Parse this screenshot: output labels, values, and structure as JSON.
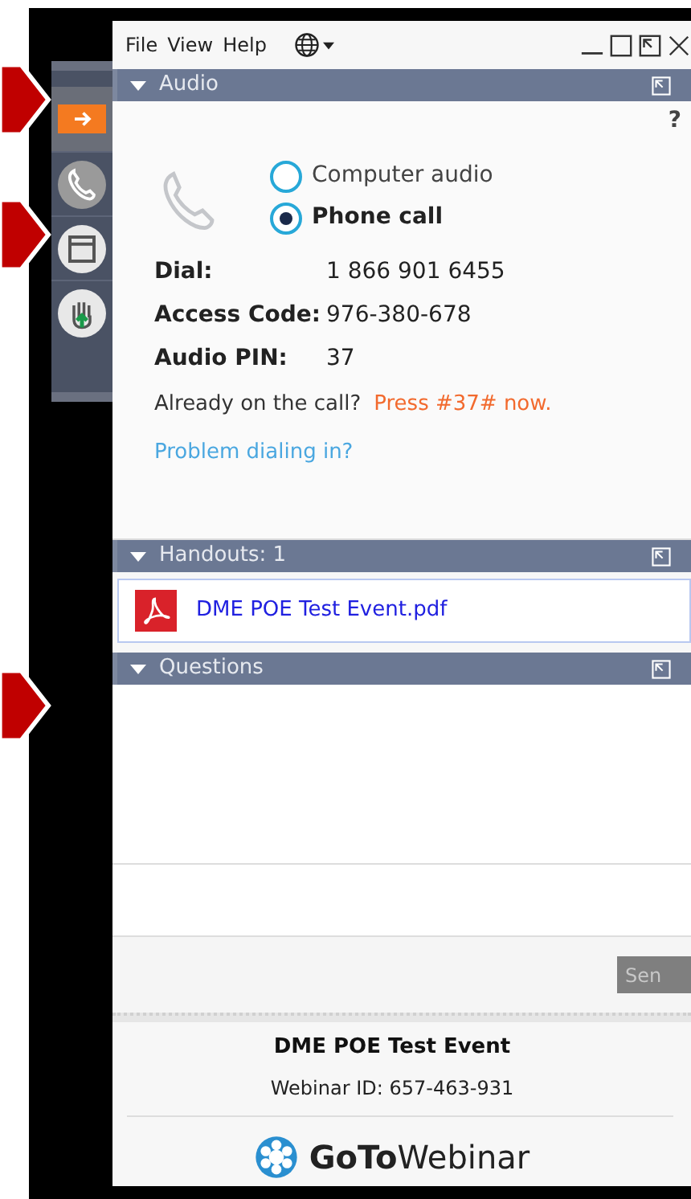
{
  "menu": [
    {
      "label": "File"
    },
    {
      "label": "View"
    },
    {
      "label": "Help"
    }
  ],
  "sidebar": {
    "items": [
      {
        "kind": "arrow",
        "selected": true
      },
      {
        "kind": "phone",
        "selected": false
      },
      {
        "kind": "window",
        "selected": false
      },
      {
        "kind": "hand",
        "selected": false
      }
    ]
  },
  "audio": {
    "title": "Audio",
    "expanded": true,
    "help": "?",
    "options": [
      {
        "label": "Computer audio",
        "selected": false
      },
      {
        "label": "Phone call",
        "selected": true
      }
    ],
    "details": [
      {
        "label": "Dial:",
        "value": "1 866 901 6455"
      },
      {
        "label": "Access Code:",
        "value": "976-380-678"
      },
      {
        "label": "Audio PIN:",
        "value": "37"
      }
    ],
    "already": {
      "text": "Already on the call?",
      "action": "Press #37# now."
    },
    "problem_link": "Problem dialing in?"
  },
  "handouts": {
    "title": "Handouts: 1",
    "expanded": true,
    "files": [
      {
        "name": "DME POE Test Event.pdf"
      }
    ]
  },
  "questions": {
    "title": "Questions",
    "expanded": true,
    "send_button": "Sen"
  },
  "footer": {
    "event_title": "DME POE Test Event",
    "webinar_id": "Webinar ID: 657-463-931",
    "logo": {
      "bold": "GoTo",
      "light": "Webinar"
    }
  }
}
